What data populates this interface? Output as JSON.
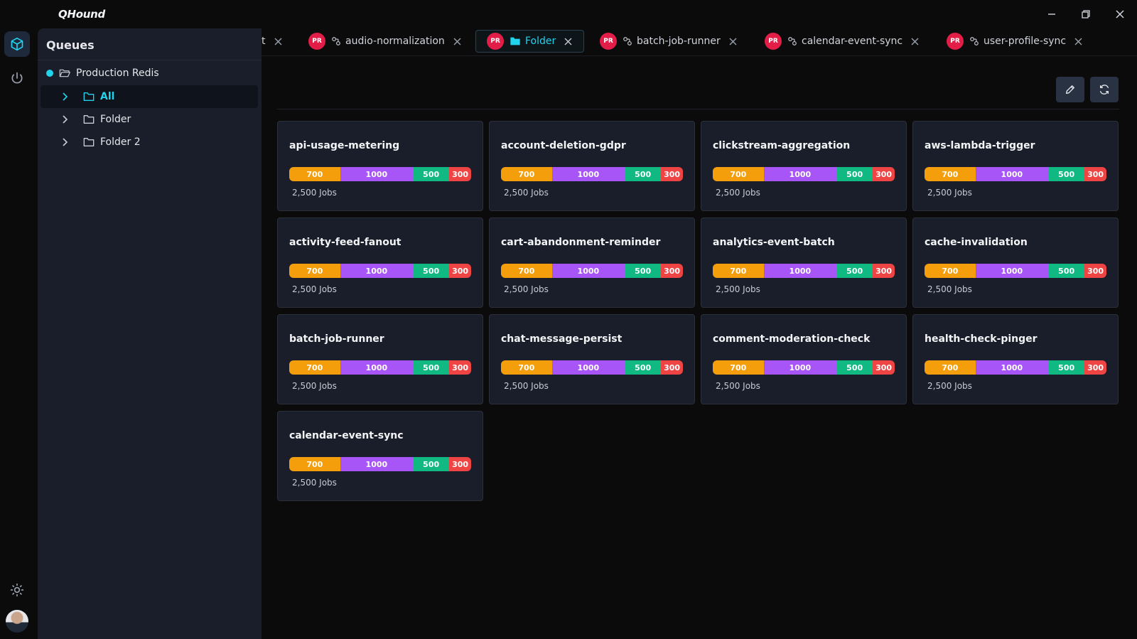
{
  "app": {
    "title": "QHound"
  },
  "colors": {
    "accent": "#22d3ee",
    "badge": "#e11d48",
    "waiting": "#f59e0b",
    "active": "#a855f7",
    "completed": "#10b981",
    "failed": "#ef4444"
  },
  "sidebar": {
    "title": "Queues",
    "connection": "Production Redis",
    "items": [
      {
        "label": "All",
        "active": true
      },
      {
        "label": "Folder",
        "active": false
      },
      {
        "label": "Folder 2",
        "active": false
      }
    ]
  },
  "tabs": [
    {
      "label": "t",
      "type": "fragment"
    },
    {
      "badge": "PR",
      "label": "audio-normalization",
      "type": "queue"
    },
    {
      "badge": "PR",
      "label": "Folder",
      "type": "folder",
      "active": true
    },
    {
      "badge": "PR",
      "label": "batch-job-runner",
      "type": "queue"
    },
    {
      "badge": "PR",
      "label": "calendar-event-sync",
      "type": "queue"
    },
    {
      "badge": "PR",
      "label": "user-profile-sync",
      "type": "queue"
    }
  ],
  "queues": [
    {
      "name": "api-usage-metering",
      "counts": [
        "700",
        "1000",
        "500",
        "300"
      ],
      "jobs": "2,500 Jobs"
    },
    {
      "name": "account-deletion-gdpr",
      "counts": [
        "700",
        "1000",
        "500",
        "300"
      ],
      "jobs": "2,500 Jobs"
    },
    {
      "name": "clickstream-aggregation",
      "counts": [
        "700",
        "1000",
        "500",
        "300"
      ],
      "jobs": "2,500 Jobs"
    },
    {
      "name": "aws-lambda-trigger",
      "counts": [
        "700",
        "1000",
        "500",
        "300"
      ],
      "jobs": "2,500 Jobs"
    },
    {
      "name": "activity-feed-fanout",
      "counts": [
        "700",
        "1000",
        "500",
        "300"
      ],
      "jobs": "2,500 Jobs"
    },
    {
      "name": "cart-abandonment-reminder",
      "counts": [
        "700",
        "1000",
        "500",
        "300"
      ],
      "jobs": "2,500 Jobs"
    },
    {
      "name": "analytics-event-batch",
      "counts": [
        "700",
        "1000",
        "500",
        "300"
      ],
      "jobs": "2,500 Jobs"
    },
    {
      "name": "cache-invalidation",
      "counts": [
        "700",
        "1000",
        "500",
        "300"
      ],
      "jobs": "2,500 Jobs"
    },
    {
      "name": "batch-job-runner",
      "counts": [
        "700",
        "1000",
        "500",
        "300"
      ],
      "jobs": "2,500 Jobs"
    },
    {
      "name": "chat-message-persist",
      "counts": [
        "700",
        "1000",
        "500",
        "300"
      ],
      "jobs": "2,500 Jobs"
    },
    {
      "name": "comment-moderation-check",
      "counts": [
        "700",
        "1000",
        "500",
        "300"
      ],
      "jobs": "2,500 Jobs"
    },
    {
      "name": "health-check-pinger",
      "counts": [
        "700",
        "1000",
        "500",
        "300"
      ],
      "jobs": "2,500 Jobs"
    },
    {
      "name": "calendar-event-sync",
      "counts": [
        "700",
        "1000",
        "500",
        "300"
      ],
      "jobs": "2,500 Jobs"
    }
  ]
}
